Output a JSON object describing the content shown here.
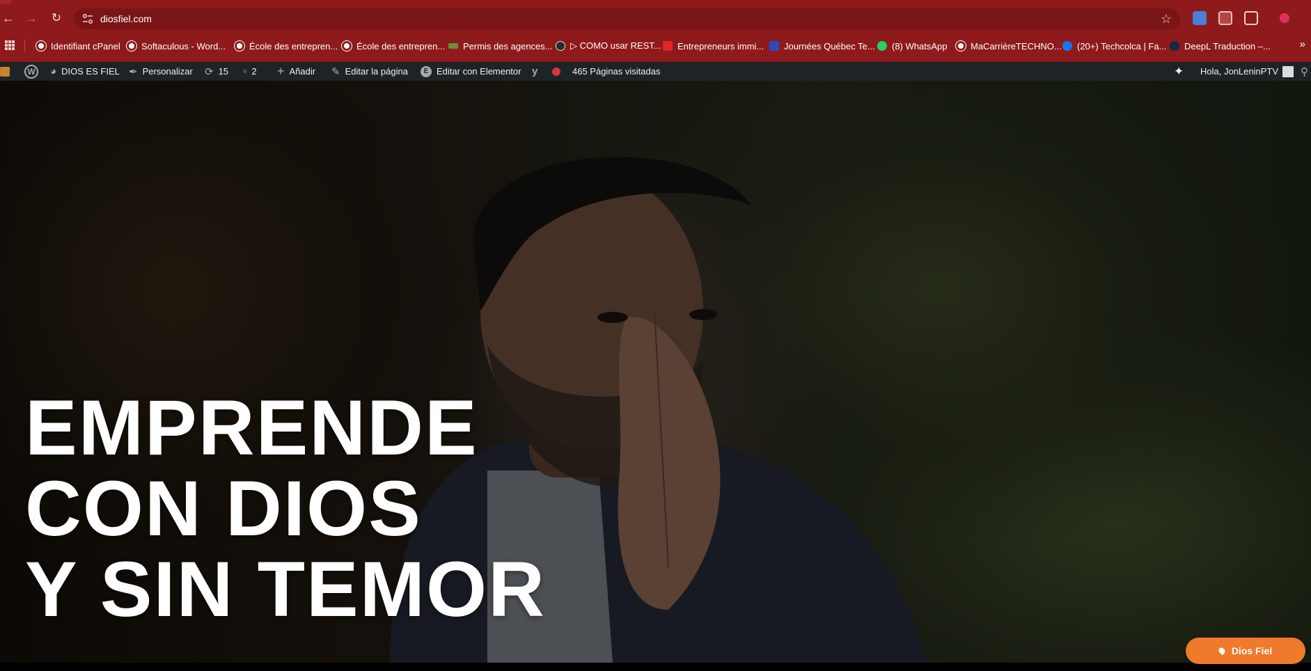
{
  "browser": {
    "url": "diosfiel.com",
    "accent_color": "#8e1a1c",
    "icons": [
      "back-icon",
      "forward-icon",
      "reload-icon",
      "site-info-icon",
      "star-icon",
      "translate-icon",
      "extensions-icon",
      "profile-icon"
    ]
  },
  "bookmarks": [
    {
      "label": "Identifiant cPanel",
      "icon": "globe-icon"
    },
    {
      "label": "Softaculous - Word...",
      "icon": "globe-icon"
    },
    {
      "label": "École des entrepren...",
      "icon": "globe-icon"
    },
    {
      "label": "École des entrepren...",
      "icon": "globe-icon"
    },
    {
      "label": "Permis des agences...",
      "icon": "permit-icon"
    },
    {
      "label": "▷ COMO usar REST...",
      "icon": "yoast-icon"
    },
    {
      "label": "Entrepreneurs immi...",
      "icon": "e-icon"
    },
    {
      "label": "Journées Québec Te...",
      "icon": "quebec-icon"
    },
    {
      "label": "(8) WhatsApp",
      "icon": "whatsapp-icon"
    },
    {
      "label": "MaCarrièreTECHNO...",
      "icon": "globe-icon"
    },
    {
      "label": "(20+) Techcolca | Fa...",
      "icon": "facebook-icon"
    },
    {
      "label": "DeepL Traduction –...",
      "icon": "deepl-icon"
    }
  ],
  "adminbar": {
    "site_name": "DIOS ES FIEL",
    "customize": "Personalizar",
    "updates": "15",
    "comments": "2",
    "add_new": "Añadir",
    "edit_page": "Editar la página",
    "edit_elementor": "Editar con Elementor",
    "page_views": "465 Páginas visitadas",
    "greeting": "Hola, JonLeninPTV"
  },
  "hero": {
    "line1": "EMPRENDE",
    "line2": "CON DIOS",
    "line3": "Y SIN TEMOR"
  },
  "cta": {
    "label": "Dios Fiel",
    "color": "#f07a2b"
  }
}
